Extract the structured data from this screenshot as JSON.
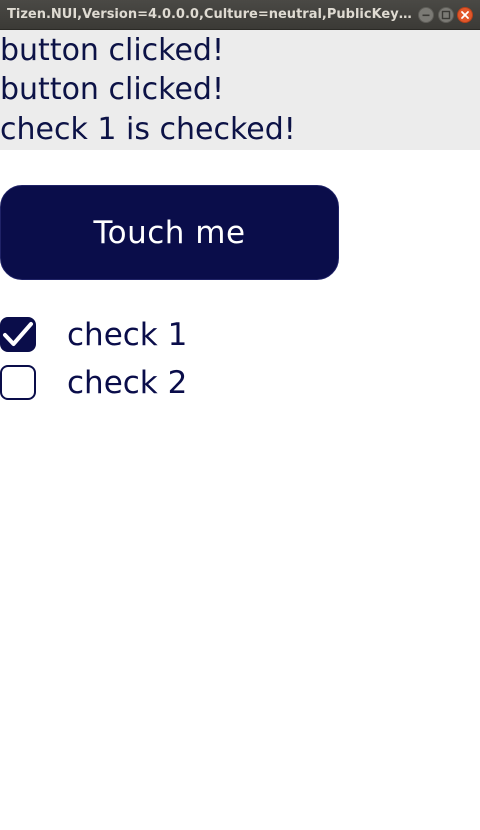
{
  "window": {
    "title": "Tizen.NUI,Version=4.0.0.0,Culture=neutral,PublicKeyTok...",
    "controls": [
      "minimize-icon",
      "maximize-icon",
      "close-icon"
    ]
  },
  "log": {
    "lines": [
      "button clicked!",
      "button clicked!",
      "check 1 is checked!"
    ]
  },
  "touch_button": {
    "label": "Touch me"
  },
  "checkboxes": [
    {
      "label": "check 1",
      "checked": true
    },
    {
      "label": "check 2",
      "checked": false
    }
  ],
  "colors": {
    "accent": "#0a0d4a",
    "log_background": "#ececec",
    "titlebar": "#3b3a36",
    "close_button": "#e2572a"
  }
}
